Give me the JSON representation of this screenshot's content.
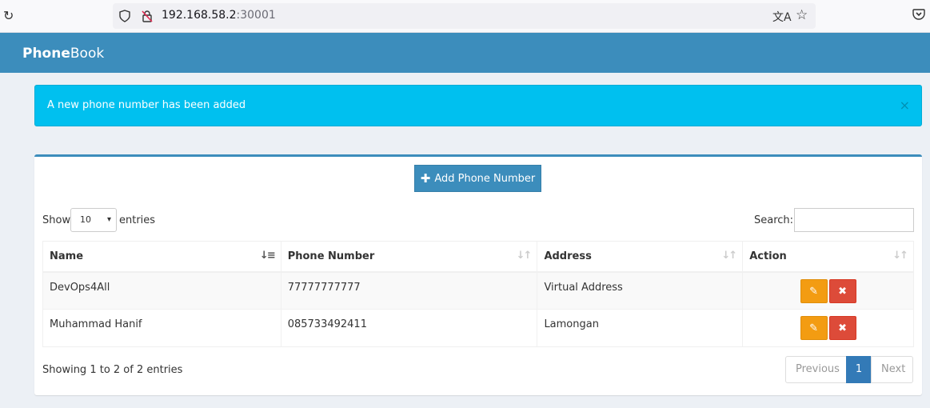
{
  "browser": {
    "url_host": "192.168.58.2",
    "url_port": ":30001"
  },
  "header": {
    "brand_bold": "Phone",
    "brand_rest": "Book"
  },
  "alert": {
    "message": "A new phone number has been added",
    "close_glyph": "×"
  },
  "toolbar": {
    "add_label": "Add Phone Number"
  },
  "table_controls": {
    "show_label": "Show",
    "page_length": "10",
    "entries_label": "entries",
    "search_label": "Search:",
    "search_value": ""
  },
  "table": {
    "columns": [
      "Name",
      "Phone Number",
      "Address",
      "Action"
    ],
    "rows": [
      {
        "name": "DevOps4All",
        "phone": "77777777777",
        "address": "Virtual Address"
      },
      {
        "name": "Muhammad Hanif",
        "phone": "085733492411",
        "address": "Lamongan"
      }
    ]
  },
  "footer": {
    "info": "Showing 1 to 2 of 2 entries",
    "prev": "Previous",
    "page": "1",
    "next": "Next"
  },
  "colors": {
    "header": "#3c8dbc",
    "alert": "#00c0ef",
    "edit": "#f39c12",
    "delete": "#dd4b39"
  }
}
